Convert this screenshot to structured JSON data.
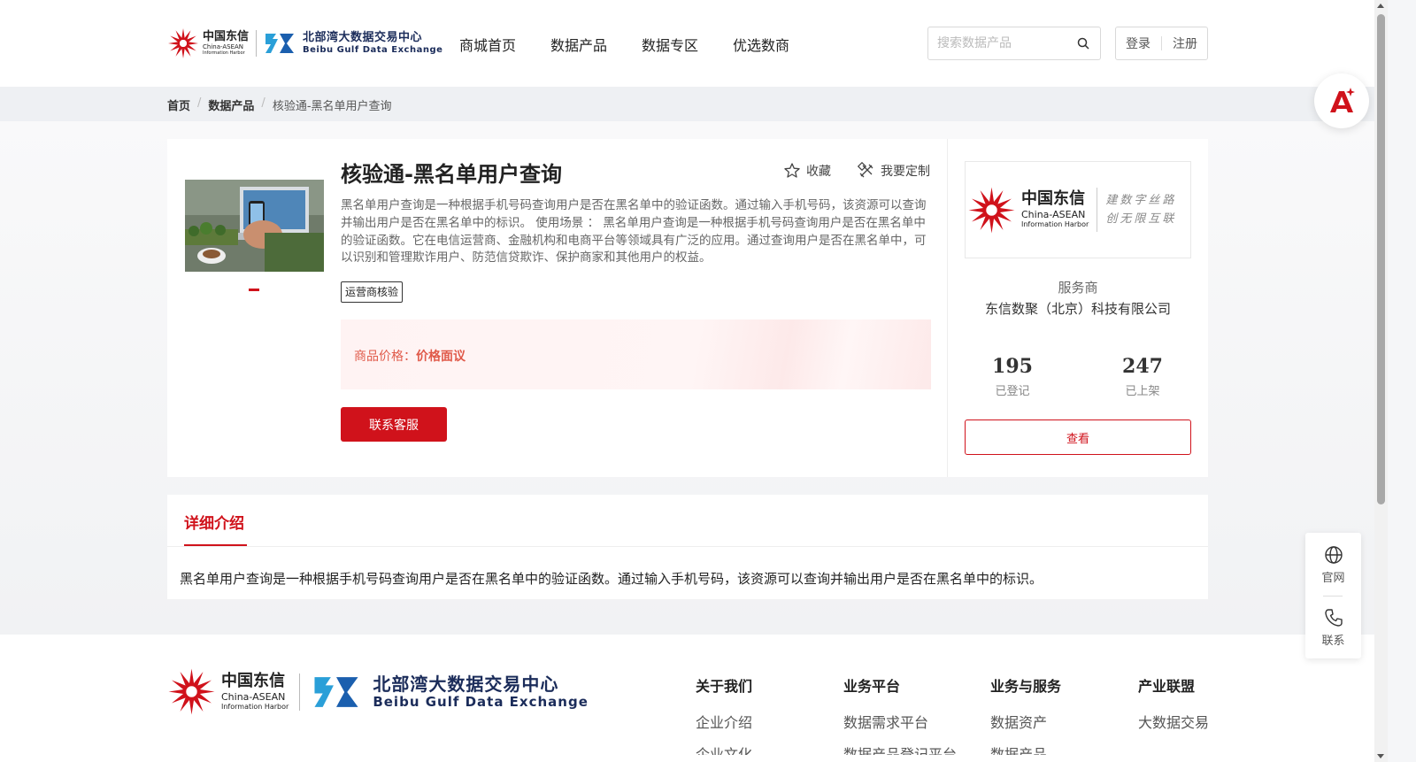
{
  "header": {
    "logo": {
      "cn": "中国东信",
      "en1": "China-ASEAN",
      "en2": "Information Harbor",
      "exchange_cn": "北部湾大数据交易中心",
      "exchange_en": "Beibu Gulf Data Exchange"
    },
    "nav": [
      "商城首页",
      "数据产品",
      "数据专区",
      "优选数商"
    ],
    "search_placeholder": "搜索数据产品",
    "login": "登录",
    "register": "注册"
  },
  "breadcrumb": {
    "home": "首页",
    "section": "数据产品",
    "current": "核验通-黑名单用户查询"
  },
  "product": {
    "title": "核验通-黑名单用户查询",
    "favorite": "收藏",
    "customize": "我要定制",
    "description": "黑名单用户查询是一种根据手机号码查询用户是否在黑名单中的验证函数。通过输入手机号码，该资源可以查询并输出用户是否在黑名单中的标识。 使用场景 ： 黑名单用户查询是一种根据手机号码查询用户是否在黑名单中的验证函数。它在电信运营商、金融机构和电商平台等领域具有广泛的应用。通过查询用户是否在黑名单中，可以识别和管理欺诈用户、防范信贷欺诈、保护商家和其他用户的权益。",
    "tag": "运营商核验",
    "price_label": "商品价格：",
    "price_value": "价格面议",
    "contact_button": "联系客服"
  },
  "provider": {
    "logo_cn": "中国东信",
    "logo_en1": "China-ASEAN",
    "logo_en2": "Information Harbor",
    "slogan1": "建数字丝路",
    "slogan2": "创无限互联",
    "role": "服务商",
    "name": "东信数聚（北京）科技有限公司",
    "registered_count": "195",
    "registered_label": "已登记",
    "listed_count": "247",
    "listed_label": "已上架",
    "view_button": "查看"
  },
  "detail": {
    "tab": "详细介绍",
    "text": "黑名单用户查询是一种根据手机号码查询用户是否在黑名单中的验证函数。通过输入手机号码，该资源可以查询并输出用户是否在黑名单中的标识。"
  },
  "footer": {
    "columns": [
      {
        "title": "关于我们",
        "items": [
          "企业介绍",
          "企业文化"
        ]
      },
      {
        "title": "业务平台",
        "items": [
          "数据需求平台",
          "数据产品登记平台"
        ]
      },
      {
        "title": "业务与服务",
        "items": [
          "数据资产",
          "数据产品"
        ]
      },
      {
        "title": "产业联盟",
        "items": [
          "大数据交易"
        ]
      }
    ]
  },
  "floating": {
    "website": "官网",
    "contact": "联系"
  },
  "colors": {
    "accent": "#d0121b",
    "price": "#e05a4a",
    "brand_navy": "#1b2c5a"
  }
}
